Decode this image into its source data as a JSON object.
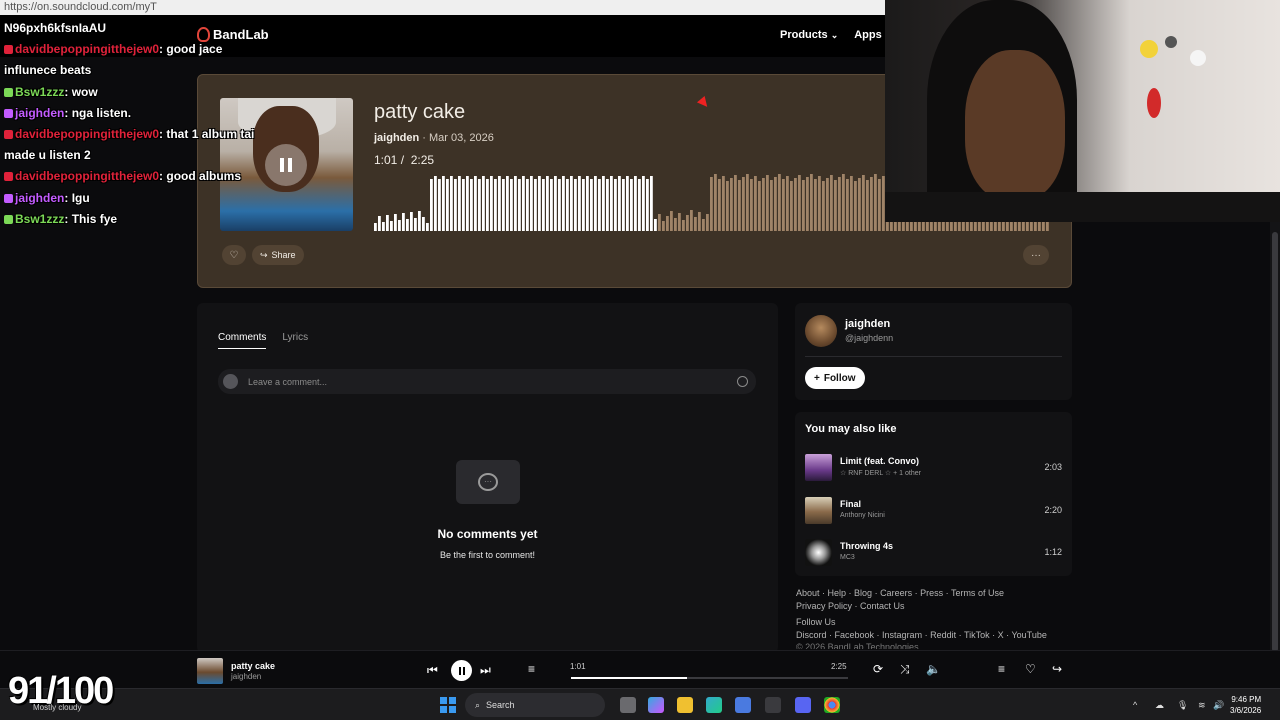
{
  "browser": {
    "url_fragment": "https://on.soundcloud.com/myT"
  },
  "header": {
    "logo": "BandLab",
    "nav": [
      {
        "label": "Products"
      },
      {
        "label": "Apps"
      }
    ]
  },
  "track": {
    "title": "patty cake",
    "artist": "jaighden",
    "date": "Mar 03, 2026",
    "current_time": "1:01",
    "duration": "2:25",
    "progress": 0.42,
    "share_label": "Share"
  },
  "comments": {
    "tab_comments": "Comments",
    "tab_lyrics": "Lyrics",
    "placeholder": "Leave a comment...",
    "empty_title": "No comments yet",
    "empty_subtitle": "Be the first to comment!"
  },
  "profile": {
    "name": "jaighden",
    "handle": "@jaighdenn",
    "follow_label": "Follow"
  },
  "recommendations": {
    "title": "You may also like",
    "items": [
      {
        "title": "Limit (feat. Convo)",
        "artist": "☆ RNF DERL ☆ + 1 other",
        "duration": "2:03"
      },
      {
        "title": "Final",
        "artist": "Anthony Nicini",
        "duration": "2:20"
      },
      {
        "title": "Throwing 4s",
        "artist": "MC3",
        "duration": "1:12"
      }
    ]
  },
  "footer": {
    "row1": [
      "About",
      "Help",
      "Blog",
      "Careers",
      "Press",
      "Terms of Use"
    ],
    "row2": [
      "Privacy Policy",
      "Contact Us"
    ],
    "follow_us": "Follow Us",
    "row3": [
      "Discord",
      "Facebook",
      "Instagram",
      "Reddit",
      "TikTok",
      "X",
      "YouTube"
    ],
    "copyright": "© 2026 BandLab Technologies"
  },
  "chat": [
    {
      "user": "",
      "msg": "N96pxh6kfsnIaAU",
      "color": "#ffffff"
    },
    {
      "user": "davidbepoppingitthejew0",
      "msg": "good jace",
      "color": "#e0223a"
    },
    {
      "user": "",
      "msg": "influnece beats",
      "color": "#ffffff"
    },
    {
      "user": "Bsw1zzz",
      "msg": "wow",
      "color": "#7cd957"
    },
    {
      "user": "jaighden",
      "msg": "nga listen.",
      "color": "#c35cff"
    },
    {
      "user": "davidbepoppingitthejew0",
      "msg": "that 1 album tai",
      "color": "#e0223a"
    },
    {
      "user": "",
      "msg": "made u listen 2",
      "color": "#ffffff"
    },
    {
      "user": "davidbepoppingitthejew0",
      "msg": "good albums",
      "color": "#e0223a"
    },
    {
      "user": "jaighden",
      "msg": "Igu",
      "color": "#c35cff"
    },
    {
      "user": "Bsw1zzz",
      "msg": "This fye",
      "color": "#7cd957"
    }
  ],
  "player": {
    "title": "patty cake",
    "artist": "jaighden",
    "current_time": "1:01",
    "duration": "2:25"
  },
  "overlay": {
    "score": "91/100",
    "weather": "Mostly cloudy"
  },
  "taskbar": {
    "search_label": "Search",
    "time": "9:46 PM",
    "date": "3/6/2026"
  },
  "colors": {
    "card_bg": "#3d3226",
    "accent": "#e1453a",
    "wave_played": "#ffffff",
    "wave_unplayed": "#a08468"
  }
}
